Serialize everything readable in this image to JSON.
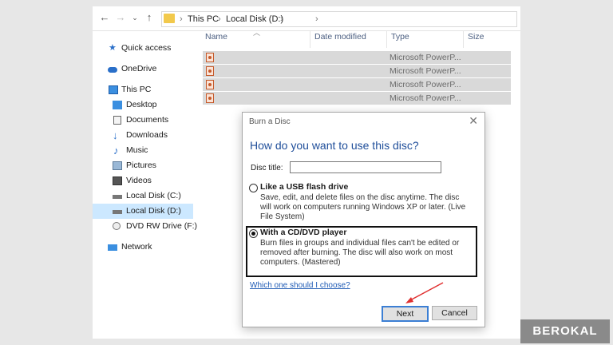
{
  "address_bar": {
    "breadcrumbs": [
      "This PC",
      "Local Disk (D:)"
    ],
    "separator": "›",
    "back_icon": "back-arrow-icon",
    "forward_icon": "forward-arrow-icon",
    "up_icon": "up-arrow-icon"
  },
  "sidebar": {
    "items": [
      {
        "label": "Quick access",
        "icon": "star-icon"
      },
      {
        "label": "OneDrive",
        "icon": "cloud-icon"
      },
      {
        "label": "This PC",
        "icon": "computer-icon"
      },
      {
        "label": "Desktop",
        "icon": "desktop-icon"
      },
      {
        "label": "Documents",
        "icon": "documents-icon"
      },
      {
        "label": "Downloads",
        "icon": "download-icon"
      },
      {
        "label": "Music",
        "icon": "music-icon"
      },
      {
        "label": "Pictures",
        "icon": "pictures-icon"
      },
      {
        "label": "Videos",
        "icon": "videos-icon"
      },
      {
        "label": "Local Disk (C:)",
        "icon": "drive-icon"
      },
      {
        "label": "Local Disk (D:)",
        "icon": "drive-icon",
        "selected": true
      },
      {
        "label": "DVD RW Drive (F:)",
        "icon": "dvd-icon"
      },
      {
        "label": "Network",
        "icon": "network-icon"
      }
    ]
  },
  "file_list": {
    "columns": [
      "Name",
      "Date modified",
      "Type",
      "Size"
    ],
    "rows": [
      {
        "type": "Microsoft PowerP..."
      },
      {
        "type": "Microsoft PowerP..."
      },
      {
        "type": "Microsoft PowerP..."
      },
      {
        "type": "Microsoft PowerP..."
      }
    ]
  },
  "dialog": {
    "title": "Burn a Disc",
    "close_label": "✕",
    "question": "How do you want to use this disc?",
    "disc_title_label": "Disc title:",
    "disc_title_value": "",
    "options": [
      {
        "title": "Like a USB flash drive",
        "description": "Save, edit, and delete files on the disc anytime. The disc will work on computers running Windows XP or later. (Live File System)",
        "selected": false
      },
      {
        "title": "With a CD/DVD player",
        "description": "Burn files in groups and individual files can't be edited or removed after burning. The disc will also work on most computers. (Mastered)",
        "selected": true
      }
    ],
    "help_link": "Which one should I choose?",
    "next_label": "Next",
    "cancel_label": "Cancel"
  },
  "watermark": {
    "text": "BEROKAL"
  },
  "colors": {
    "accent": "#1f4e9a",
    "selection": "#cce8ff",
    "annotation_arrow": "#e03030"
  }
}
